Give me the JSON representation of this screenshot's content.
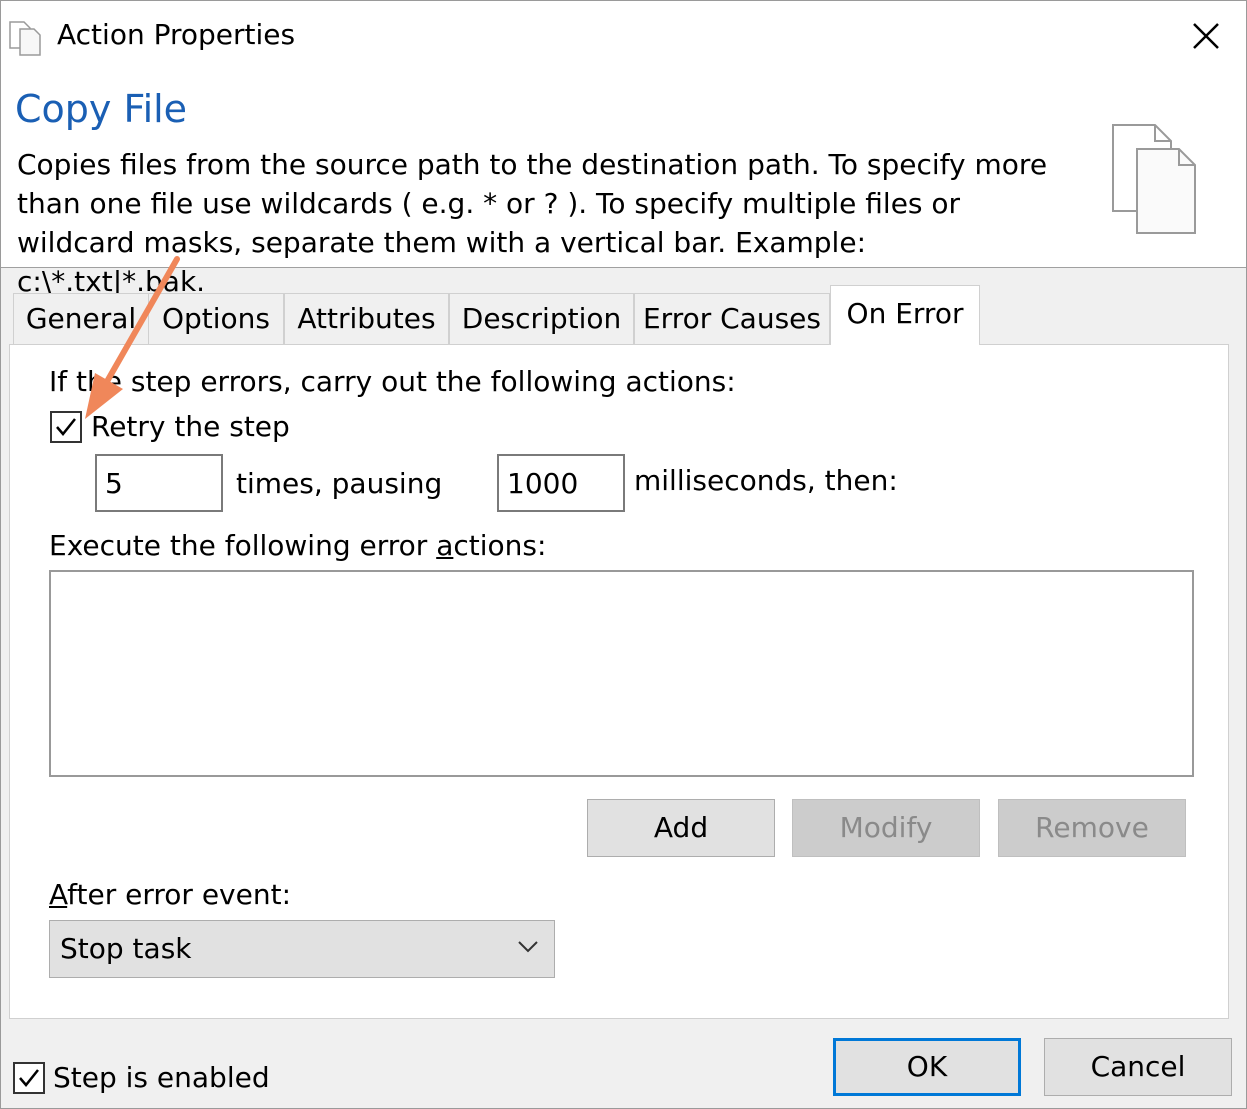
{
  "window": {
    "title": "Action Properties"
  },
  "header": {
    "title": "Copy File",
    "description": "Copies files from the source path to the destination path.  To specify more\nthan one file use wildcards ( e.g. * or ? ).  To specify multiple files or\nwildcard masks, separate them with a vertical bar.  Example: c:\\*.txt|*.bak."
  },
  "tabs": [
    {
      "label": "General"
    },
    {
      "label": "Options"
    },
    {
      "label": "Attributes"
    },
    {
      "label": "Description"
    },
    {
      "label": "Error Causes"
    },
    {
      "label": "On Error",
      "active": true
    }
  ],
  "on_error": {
    "intro": "If the step errors, carry out the following actions:",
    "retry_label": "Retry the step",
    "retry_checked": true,
    "times_value": "5",
    "times_label": "times, pausing",
    "pause_value": "1000",
    "pause_label": "milliseconds, then:",
    "actions_label_pre": "Execute the following error ",
    "actions_label_key": "a",
    "actions_label_post": "ctions:",
    "add_label": "Add",
    "modify_label": "Modify",
    "remove_label": "Remove",
    "after_label_key": "A",
    "after_label_post": "fter error event:",
    "after_value": "Stop task"
  },
  "footer": {
    "enabled_label": "Step is enabled",
    "enabled_checked": true,
    "ok_label": "OK",
    "cancel_label": "Cancel"
  },
  "colors": {
    "accent_title": "#1a5fb4",
    "default_button_border": "#0078d7",
    "annotation_arrow": "#f0875a"
  }
}
